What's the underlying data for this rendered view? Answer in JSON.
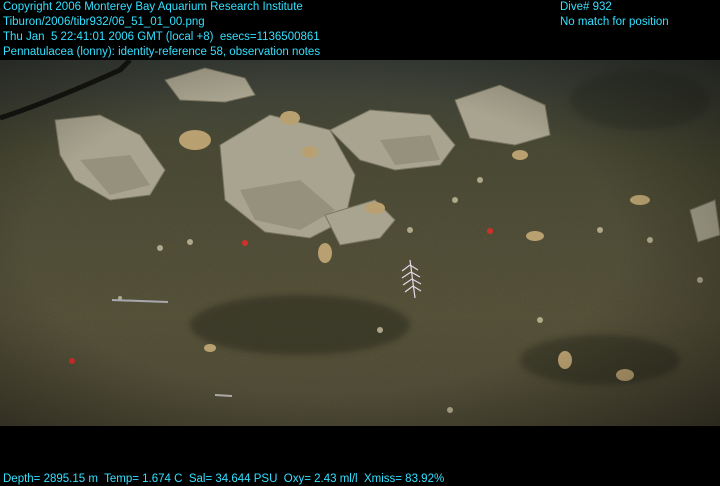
{
  "overlay": {
    "copyright": "Copyright 2006 Monterey Bay Aquarium Research Institute",
    "file_path": "Tiburon/2006/tibr932/06_51_01_00.png",
    "timestamp": "Thu Jan  5 22:41:01 2006 GMT (local +8)  esecs=1136500861",
    "annotation": "Pennatulacea (lonny): identity-reference 58, observation notes",
    "dive": "Dive# 932",
    "position_status": "No match for position",
    "telemetry": "Depth= 2895.15 m  Temp= 1.674 C  Sal= 34.644 PSU  Oxy= 2.43 ml/l  Xmiss= 83.92%"
  },
  "colors": {
    "overlay_text": "#33e0ff",
    "seafloor": "#4a4a32",
    "background": "#000000"
  }
}
